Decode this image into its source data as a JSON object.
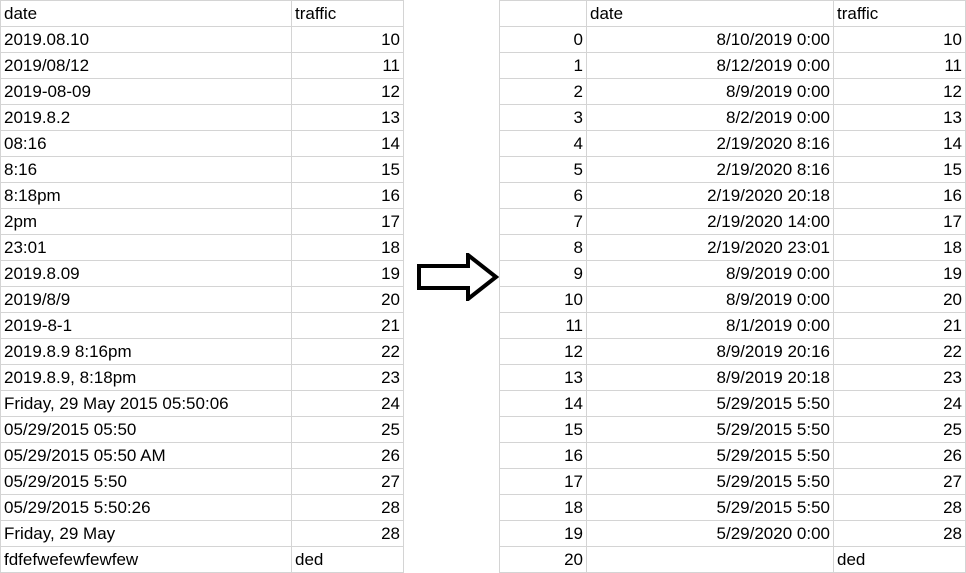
{
  "left_table": {
    "headers": [
      "date",
      "traffic"
    ],
    "rows": [
      [
        "2019.08.10",
        "10"
      ],
      [
        "2019/08/12",
        "11"
      ],
      [
        "2019-08-09",
        "12"
      ],
      [
        "2019.8.2",
        "13"
      ],
      [
        "08:16",
        "14"
      ],
      [
        "8:16",
        "15"
      ],
      [
        "8:18pm",
        "16"
      ],
      [
        "2pm",
        "17"
      ],
      [
        "23:01",
        "18"
      ],
      [
        "2019.8.09",
        "19"
      ],
      [
        "2019/8/9",
        "20"
      ],
      [
        "2019-8-1",
        "21"
      ],
      [
        "2019.8.9 8:16pm",
        "22"
      ],
      [
        "2019.8.9, 8:18pm",
        "23"
      ],
      [
        "Friday, 29 May 2015 05:50:06",
        "24"
      ],
      [
        "05/29/2015 05:50",
        "25"
      ],
      [
        "05/29/2015 05:50 AM",
        "26"
      ],
      [
        "05/29/2015 5:50",
        "27"
      ],
      [
        "05/29/2015 5:50:26",
        "28"
      ],
      [
        "Friday, 29 May",
        "28"
      ],
      [
        "fdfefwefewfewfew",
        "ded"
      ]
    ]
  },
  "arrow_icon": "right-arrow-icon",
  "right_table": {
    "headers": [
      "",
      "date",
      "traffic"
    ],
    "rows": [
      [
        "0",
        "8/10/2019 0:00",
        "10"
      ],
      [
        "1",
        "8/12/2019 0:00",
        "11"
      ],
      [
        "2",
        "8/9/2019 0:00",
        "12"
      ],
      [
        "3",
        "8/2/2019 0:00",
        "13"
      ],
      [
        "4",
        "2/19/2020 8:16",
        "14"
      ],
      [
        "5",
        "2/19/2020 8:16",
        "15"
      ],
      [
        "6",
        "2/19/2020 20:18",
        "16"
      ],
      [
        "7",
        "2/19/2020 14:00",
        "17"
      ],
      [
        "8",
        "2/19/2020 23:01",
        "18"
      ],
      [
        "9",
        "8/9/2019 0:00",
        "19"
      ],
      [
        "10",
        "8/9/2019 0:00",
        "20"
      ],
      [
        "11",
        "8/1/2019 0:00",
        "21"
      ],
      [
        "12",
        "8/9/2019 20:16",
        "22"
      ],
      [
        "13",
        "8/9/2019 20:18",
        "23"
      ],
      [
        "14",
        "5/29/2015 5:50",
        "24"
      ],
      [
        "15",
        "5/29/2015 5:50",
        "25"
      ],
      [
        "16",
        "5/29/2015 5:50",
        "26"
      ],
      [
        "17",
        "5/29/2015 5:50",
        "27"
      ],
      [
        "18",
        "5/29/2015 5:50",
        "28"
      ],
      [
        "19",
        "5/29/2020 0:00",
        "28"
      ],
      [
        "20",
        "",
        "ded"
      ]
    ]
  }
}
